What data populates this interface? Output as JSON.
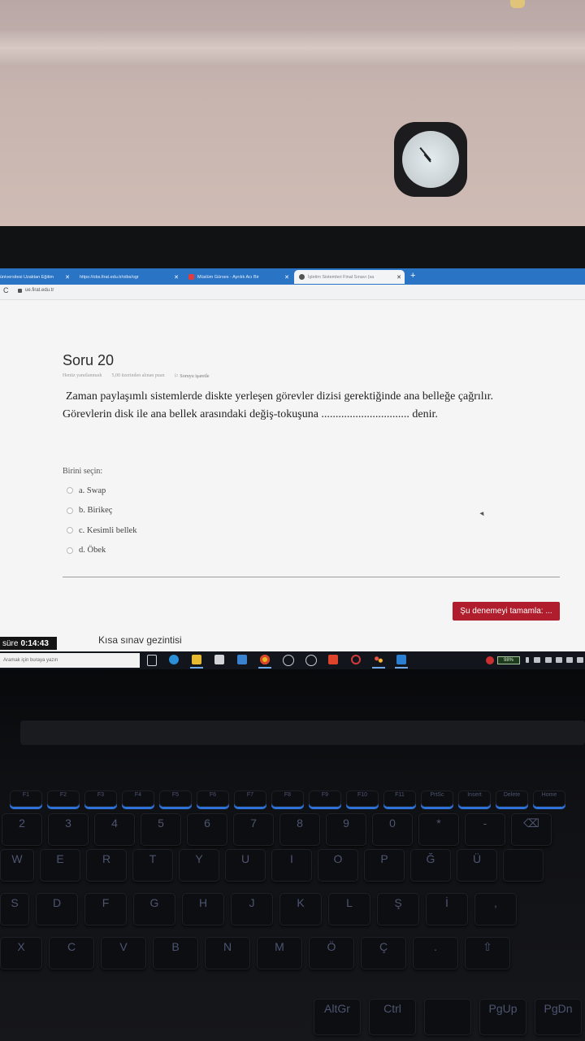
{
  "browser": {
    "tabs": [
      {
        "label": "üniversitesi Uzaktan Eğitim",
        "favicon_color": "#6a9fd8"
      },
      {
        "label": "https://obs.firat.edu.tr/oibs/ogr",
        "favicon_color": "#9ab7dd"
      },
      {
        "label": "Müslüm Gürses - Ayrılık Acı Bir",
        "favicon_color": "#e23b3b"
      },
      {
        "label": "İşletim Sistemleri Final Sınavı (sa",
        "favicon_color": "#555555"
      }
    ],
    "new_tab": "+",
    "close_glyph": "✕",
    "url": "ue.firat.edu.tr",
    "reload_glyph": "C"
  },
  "quiz": {
    "title": "Soru 20",
    "meta": {
      "status": "Henüz yanıtlanmadı",
      "points": "5,00 üzerinden alınan puan",
      "flag": "Soruyu işaretle"
    },
    "question_line1": "Zaman paylaşımlı sistemlerde diskte yerleşen görevler dizisi gerektiğinde ana belleğe çağrılır.",
    "question_line2": "Görevlerin disk ile ana bellek arasındaki değiş-tokuşuna ............................... denir.",
    "choose_label": "Birini seçin:",
    "options": [
      {
        "label": "a. Swap"
      },
      {
        "label": "b. Birikeç"
      },
      {
        "label": "c. Kesimli bellek"
      },
      {
        "label": "d. Öbek"
      }
    ],
    "finish_button": "Şu denemeyi tamamla: ...",
    "timer_label": "süre",
    "timer_value": "0:14:43",
    "nav_title": "Kısa sınav gezintisi"
  },
  "taskbar": {
    "search_placeholder": "Aramak için buraya yazın",
    "battery": "98%",
    "icons": [
      "task-view-icon",
      "edge-icon",
      "file-explorer-icon",
      "store-icon",
      "mail-icon",
      "chrome-icon",
      "browser-icon",
      "app-icon",
      "office-icon",
      "opera-icon",
      "paint-icon",
      "media-icon"
    ]
  },
  "colors": {
    "tabbar": "#2a74c5",
    "finish_button": "#b01e2d",
    "key_backlight": "#2d72d8"
  },
  "keyboard": {
    "fn_row": [
      "F1",
      "F2",
      "F3",
      "F4",
      "F5",
      "F6",
      "F7",
      "F8",
      "F9",
      "F10",
      "F11",
      "PrtSc",
      "Insert",
      "Delete",
      "Home"
    ],
    "row1": [
      "2",
      "3",
      "4",
      "5",
      "6",
      "7",
      "8",
      "9",
      "0",
      "*",
      "-",
      "⌫"
    ],
    "row2": [
      "W",
      "E",
      "R",
      "T",
      "Y",
      "U",
      "I",
      "O",
      "P",
      "Ğ",
      "Ü",
      ""
    ],
    "row3": [
      "S",
      "D",
      "F",
      "G",
      "H",
      "J",
      "K",
      "L",
      "Ş",
      "İ",
      ","
    ],
    "row4": [
      "X",
      "C",
      "V",
      "B",
      "N",
      "M",
      "Ö",
      "Ç",
      ".",
      "⇧"
    ],
    "row5": [
      "AltGr",
      "Ctrl",
      "",
      "PgUp",
      "PgDn"
    ]
  }
}
